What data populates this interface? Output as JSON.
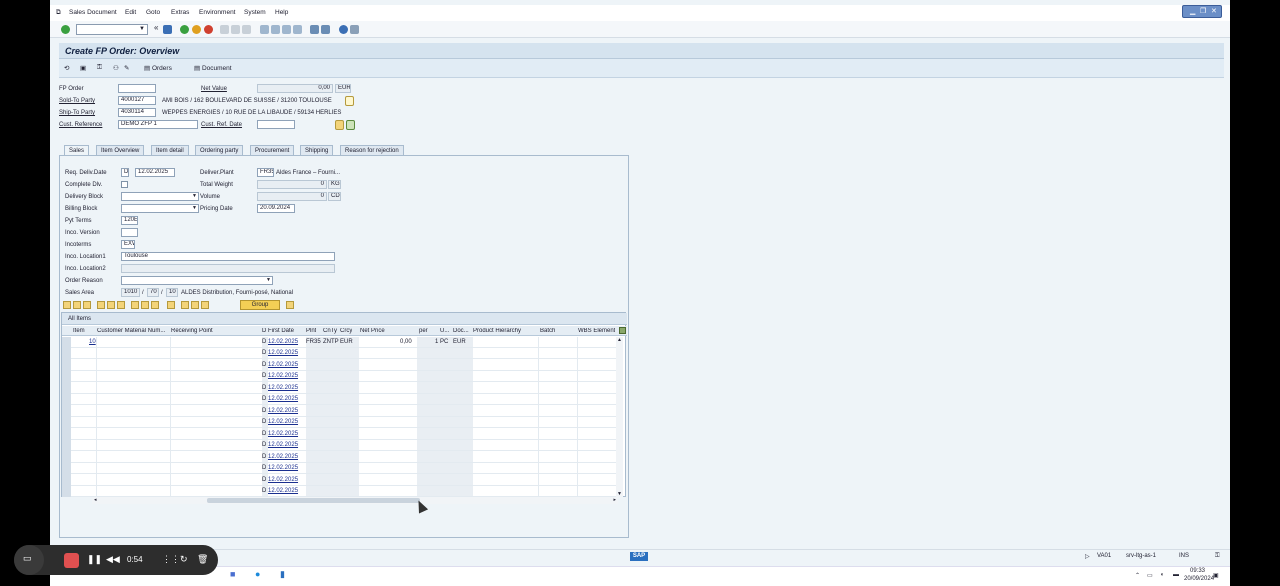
{
  "menu": [
    "Sales Document",
    "Edit",
    "Goto",
    "Extras",
    "Environment",
    "System",
    "Help"
  ],
  "title": "Create FP Order: Overview",
  "app_toolbar": {
    "orders_label": "Orders",
    "document_label": "Document"
  },
  "header": {
    "fp_order_label": "FP Order",
    "net_value_label": "Net Value",
    "net_value": "0,00",
    "currency": "EUR",
    "sold_to_label": "Sold-To Party",
    "sold_to_value": "4000127",
    "sold_to_desc": "AMI BOIS / 162 BOULEVARD DE SUISSE / 31200 TOULOUSE",
    "ship_to_label": "Ship-To Party",
    "ship_to_value": "4030114",
    "ship_to_desc": "WEPPES ENERGIES / 10 RUE DE LA LIBAUDE / 59134 HERLIES",
    "cust_ref_label": "Cust. Reference",
    "cust_ref_value": "DEMO ZFP 1",
    "cust_ref_date_label": "Cust. Ref. Date"
  },
  "tabs": [
    "Sales",
    "Item Overview",
    "Item detail",
    "Ordering party",
    "Procurement",
    "Shipping",
    "Reason for rejection"
  ],
  "sales": {
    "req_deliv_label": "Req. Deliv.Date",
    "req_deliv_d": "D",
    "req_deliv_value": "12.02.2025",
    "deliver_plant_label": "Deliver.Plant",
    "deliver_plant_code": "FR35",
    "deliver_plant_desc": "Aldes France – Fourni...",
    "complete_dlv_label": "Complete Dlv.",
    "total_weight_label": "Total Weight",
    "total_weight_value": "0",
    "total_weight_unit": "KG",
    "delivery_block_label": "Delivery Block",
    "volume_label": "Volume",
    "volume_value": "0",
    "volume_unit": "CD3",
    "billing_block_label": "Billing Block",
    "pricing_date_label": "Pricing Date",
    "pricing_date_value": "20.09.2024",
    "pyt_terms_label": "Pyt Terms",
    "pyt_terms_value": "120E",
    "inco_version_label": "Inco. Version",
    "incoterms_label": "Incoterms",
    "incoterms_value": "EXW",
    "inco_loc1_label": "Inco. Location1",
    "inco_loc1_value": "Toulouse",
    "inco_loc2_label": "Inco. Location2",
    "order_reason_label": "Order Reason",
    "sales_area_label": "Sales Area",
    "sales_org": "1010",
    "dist_channel": "70",
    "division": "10",
    "sales_area_desc": "ALDES Distribution, Fourni-posé, National"
  },
  "items_toolbar": {
    "group_label": "Group"
  },
  "items_table": {
    "title": "All Items",
    "columns": [
      "Item",
      "Customer Material Num...",
      "Receiving Point",
      "D",
      "First Date",
      "Plnt",
      "CnTy",
      "Crcy",
      "Net Price",
      "per",
      "U...",
      "Doc...",
      "Product Hierarchy",
      "Batch",
      "WBS Element"
    ],
    "first_row": {
      "item": "10",
      "d": "D",
      "date": "12.02.2025",
      "plnt": "FR35",
      "cnty": "ZNTP",
      "crcy": "EUR",
      "net_price": "0,00",
      "per": "1",
      "unit": "PC",
      "doc_crcy": "EUR"
    },
    "empty_rows": [
      {
        "d": "D",
        "date": "12.02.2025"
      },
      {
        "d": "D",
        "date": "12.02.2025"
      },
      {
        "d": "D",
        "date": "12.02.2025"
      },
      {
        "d": "D",
        "date": "12.02.2025"
      },
      {
        "d": "D",
        "date": "12.02.2025"
      },
      {
        "d": "D",
        "date": "12.02.2025"
      },
      {
        "d": "D",
        "date": "12.02.2025"
      },
      {
        "d": "D",
        "date": "12.02.2025"
      },
      {
        "d": "D",
        "date": "12.02.2025"
      },
      {
        "d": "D",
        "date": "12.02.2025"
      },
      {
        "d": "D",
        "date": "12.02.2025"
      },
      {
        "d": "D",
        "date": "12.02.2025"
      },
      {
        "d": "D",
        "date": "12.02.2025"
      }
    ]
  },
  "status": {
    "sap_logo": "SAP",
    "transaction": "VA01",
    "server": "srv-ltg-as-1",
    "mode": "INS"
  },
  "taskbar": {
    "time": "09:33",
    "date": "20/09/2024"
  },
  "recorder": {
    "elapsed": "0:54"
  }
}
